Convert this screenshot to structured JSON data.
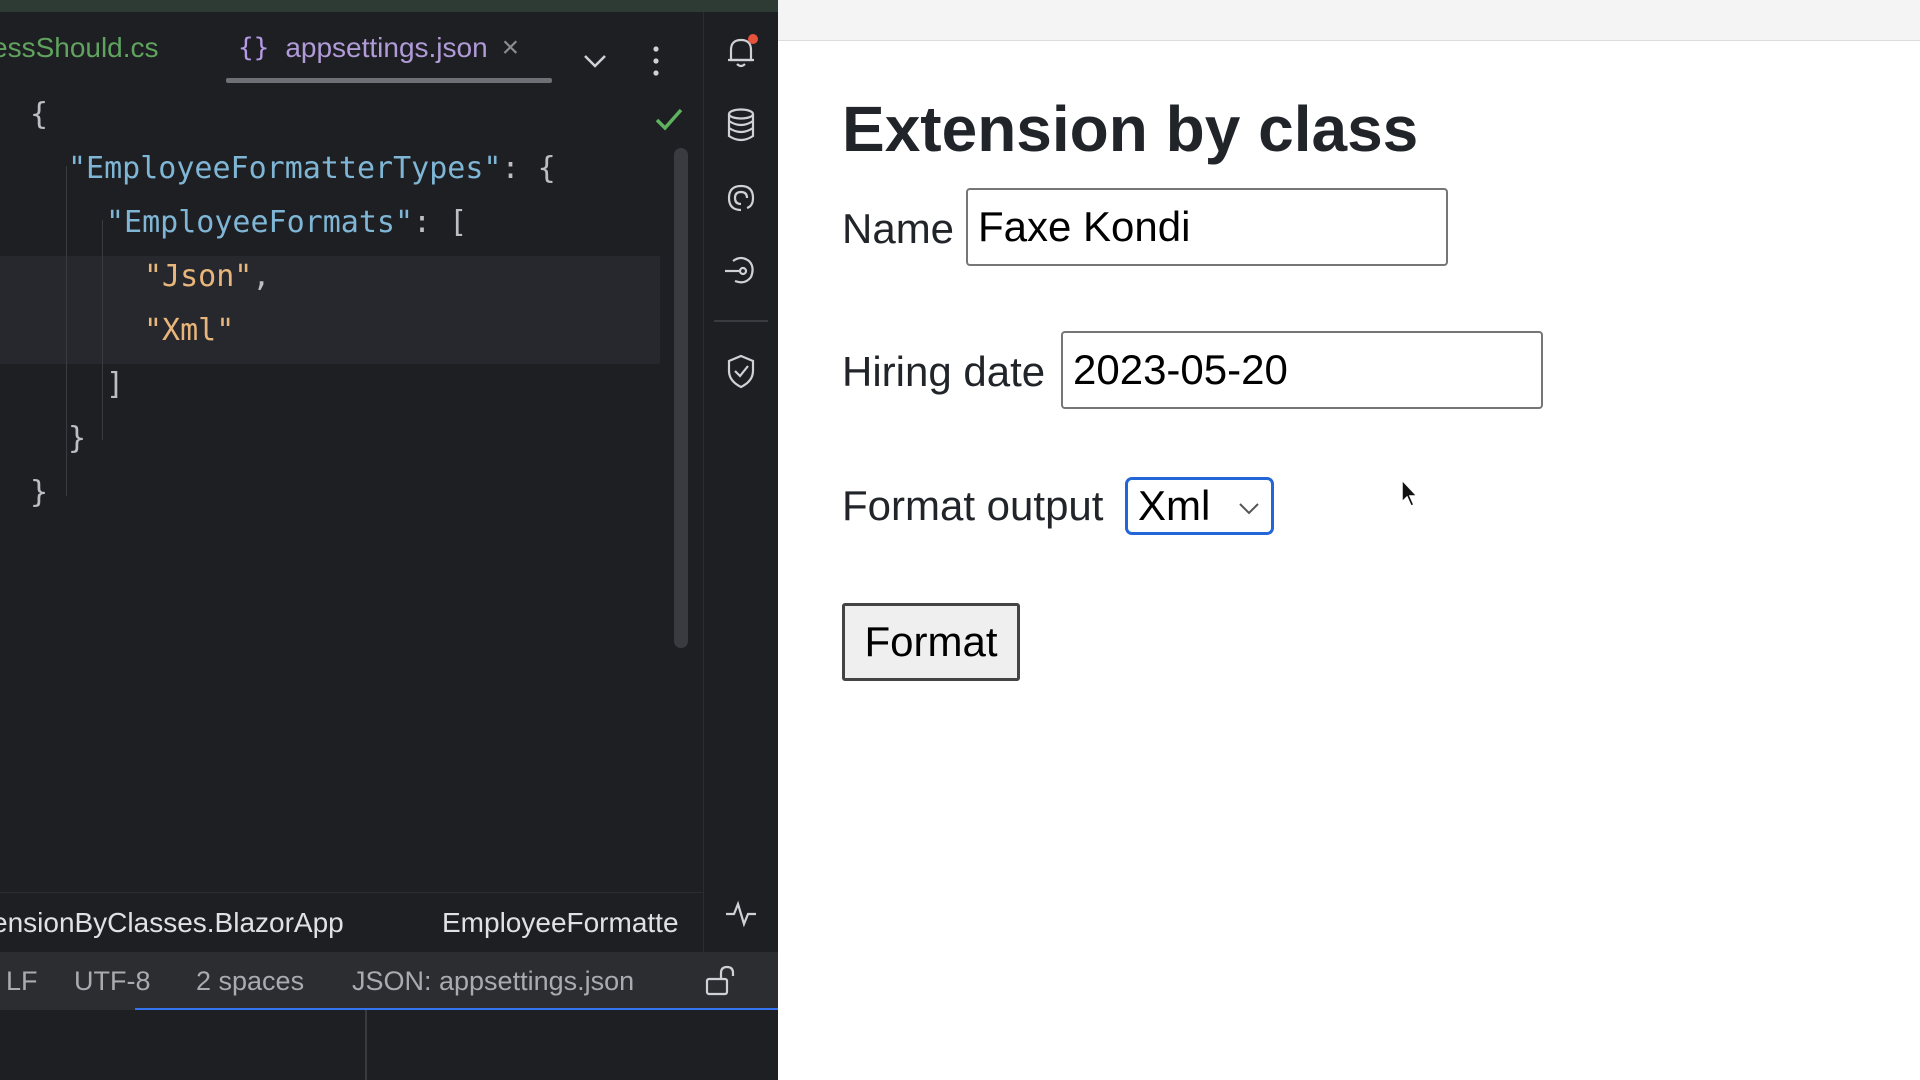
{
  "ide": {
    "tabs": [
      {
        "label": "essShould.cs"
      },
      {
        "label": "appsettings.json",
        "icon": "json-braces-icon",
        "close": "×"
      }
    ],
    "code": {
      "line1": "{",
      "line2_key": "\"EmployeeFormatterTypes\"",
      "line2_rest": ": {",
      "line3_key": "\"EmployeeFormats\"",
      "line3_rest": ": [",
      "line4_str": "\"Json\"",
      "line4_rest": ",",
      "line5_str": "\"Xml\"",
      "line6": "]",
      "line7": "}",
      "line8": "}"
    },
    "breadcrumb": [
      "ensionByClasses.BlazorApp",
      "EmployeeFormatte"
    ],
    "status": {
      "line_ending": "LF",
      "encoding": "UTF-8",
      "indent": "2 spaces",
      "file_type": "JSON: appsettings.json"
    },
    "colors": {
      "accent": "#3574f0",
      "string": "#e8b67a",
      "key": "#7fb6d6"
    }
  },
  "page": {
    "title": "Extension by class",
    "name_label": "Name",
    "name_value": "Faxe Kondi",
    "date_label": "Hiring date",
    "date_value": "2023-05-20",
    "format_label": "Format output",
    "format_selected": "Xml",
    "format_button": "Format"
  }
}
